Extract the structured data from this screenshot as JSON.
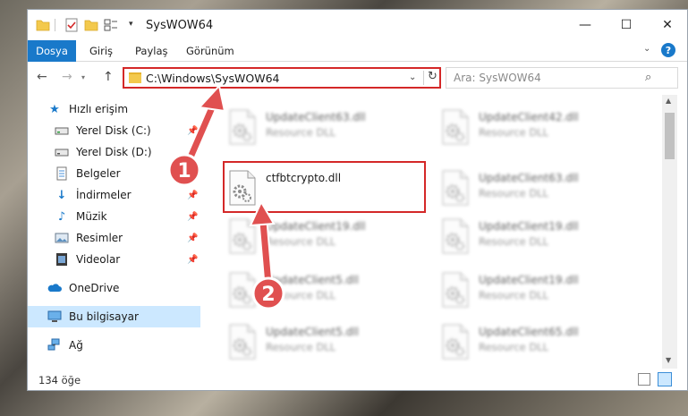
{
  "window": {
    "title": "SysWOW64",
    "quick_access_dropdown": "▾",
    "controls": {
      "minimize": "—",
      "maximize": "☐",
      "close": "✕"
    }
  },
  "ribbon": {
    "tabs": [
      {
        "label": "Dosya",
        "active": true
      },
      {
        "label": "Giriş"
      },
      {
        "label": "Paylaş"
      },
      {
        "label": "Görünüm"
      }
    ],
    "expand_chevron": "⌄",
    "help": "?"
  },
  "nav": {
    "address": "C:\\Windows\\SysWOW64",
    "search_placeholder": "Ara: SysWOW64"
  },
  "sidebar": {
    "items": [
      {
        "label": "Hızlı erişim",
        "icon": "star-icon"
      },
      {
        "label": "Yerel Disk (C:)",
        "icon": "drive-icon",
        "pinned": true
      },
      {
        "label": "Yerel Disk (D:)",
        "icon": "drive-icon",
        "pinned": true
      },
      {
        "label": "Belgeler",
        "icon": "documents-icon",
        "pinned": true
      },
      {
        "label": "İndirmeler",
        "icon": "download-icon",
        "pinned": true
      },
      {
        "label": "Müzik",
        "icon": "music-icon",
        "pinned": true
      },
      {
        "label": "Resimler",
        "icon": "pictures-icon",
        "pinned": true
      },
      {
        "label": "Videolar",
        "icon": "videos-icon",
        "pinned": true
      },
      {
        "label": "OneDrive",
        "icon": "cloud-icon"
      },
      {
        "label": "Bu bilgisayar",
        "icon": "computer-icon",
        "selected": true
      },
      {
        "label": "Ağ",
        "icon": "network-icon"
      }
    ]
  },
  "files": [
    {
      "name": "UpdateClient63.dll",
      "type": "Resource DLL",
      "blurred": true
    },
    {
      "name": "UpdateClient42.dll",
      "type": "Resource DLL",
      "blurred": true
    },
    {
      "name": "ctfbtcrypto.dll",
      "type": "",
      "blurred": false
    },
    {
      "name": "UpdateClient63.dll",
      "type": "Resource DLL",
      "blurred": true
    },
    {
      "name": "UpdateClient19.dll",
      "type": "Resource DLL",
      "blurred": true
    },
    {
      "name": "UpdateClient19.dll",
      "type": "Resource DLL",
      "blurred": true
    },
    {
      "name": "UpdateClient5.dll",
      "type": "Resource DLL",
      "blurred": true
    },
    {
      "name": "UpdateClient19.dll",
      "type": "Resource DLL",
      "blurred": true
    },
    {
      "name": "UpdateClient5.dll",
      "type": "Resource DLL",
      "blurred": true
    },
    {
      "name": "UpdateClient65.dll",
      "type": "Resource DLL",
      "blurred": true
    }
  ],
  "status": {
    "item_count": "134 öğe"
  },
  "annotations": {
    "step1": "1",
    "step2": "2",
    "highlight_color": "#d42828",
    "arrow_color": "#e05050"
  },
  "colors": {
    "accent": "#1979ca",
    "selection": "#cce8ff"
  }
}
